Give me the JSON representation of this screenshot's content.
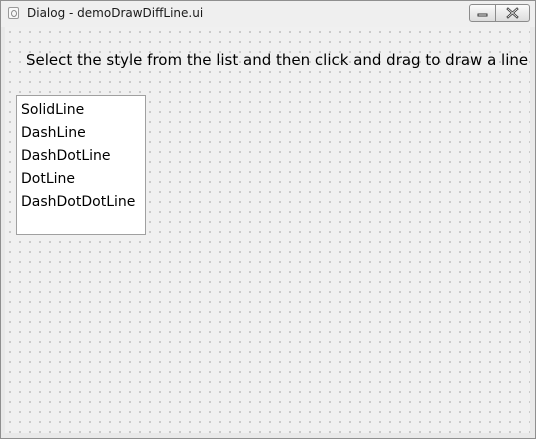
{
  "window": {
    "title": "Dialog - demoDrawDiffLine.ui",
    "app_icon": "qt-app-icon",
    "minimize_icon": "minimize-icon",
    "close_icon": "close-icon"
  },
  "content": {
    "instruction": "Select the style from the list and then click and drag to draw a line",
    "style_list": {
      "items": [
        {
          "label": "SolidLine"
        },
        {
          "label": "DashLine"
        },
        {
          "label": "DashDotLine"
        },
        {
          "label": "DotLine"
        },
        {
          "label": "DashDotDotLine"
        }
      ]
    }
  },
  "colors": {
    "canvas_background": "#f0f0f0",
    "grid_dot": "#9a9a9a",
    "list_background": "#ffffff"
  }
}
